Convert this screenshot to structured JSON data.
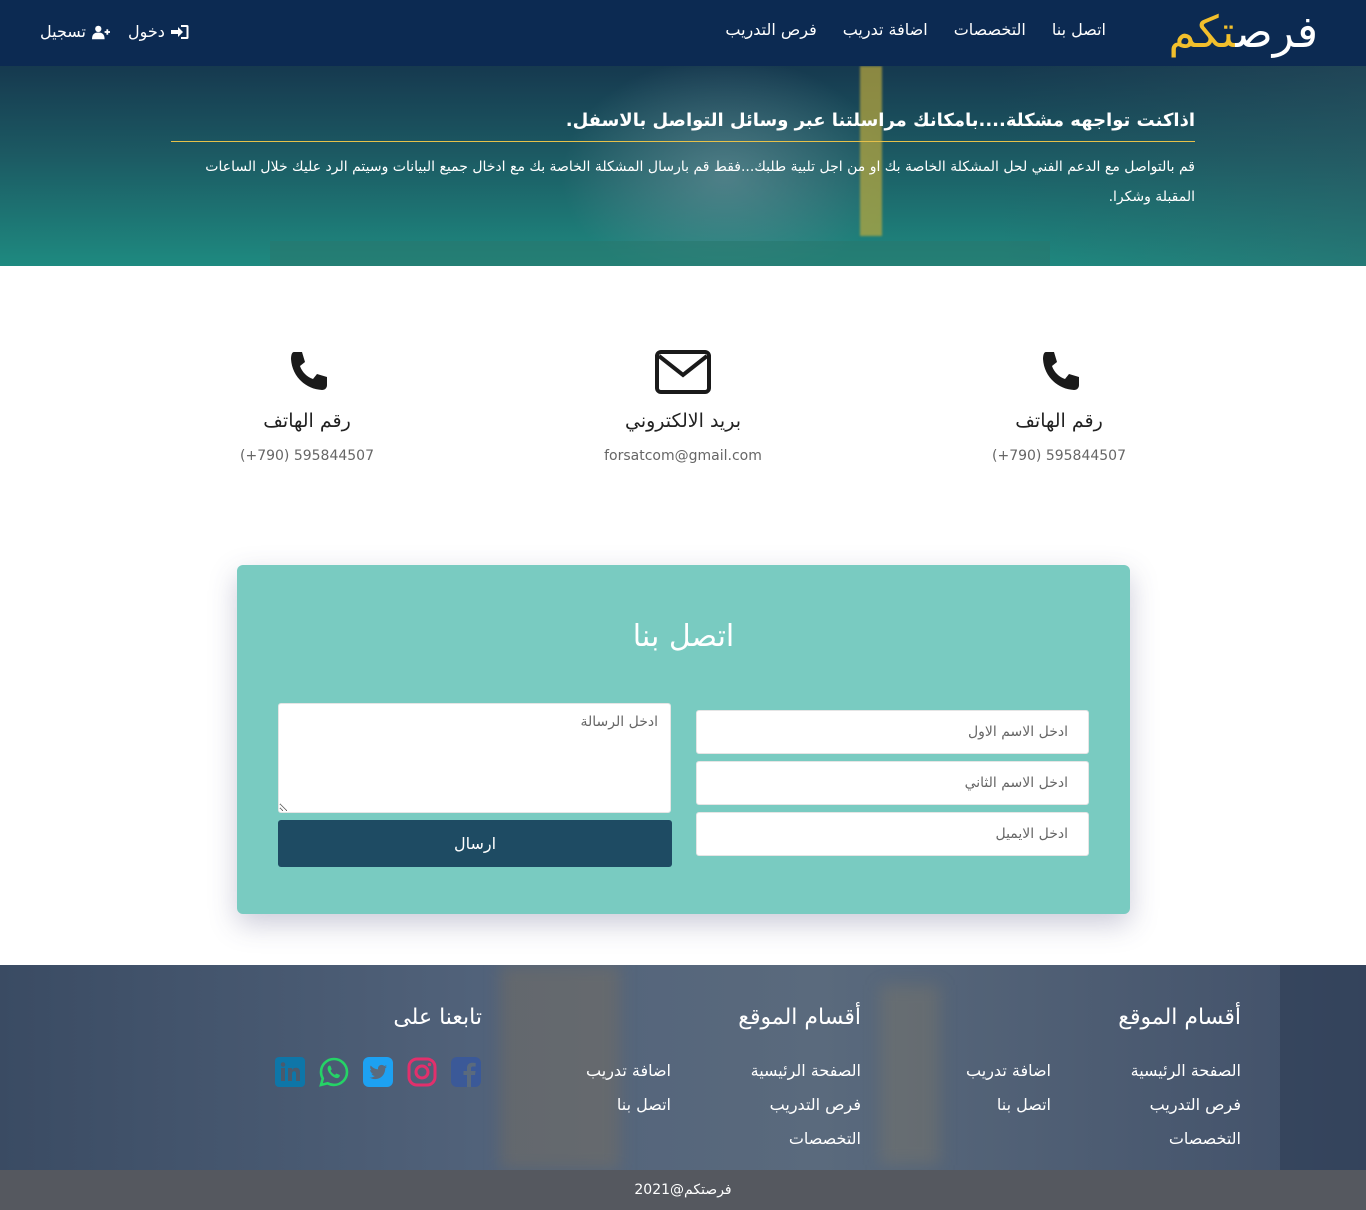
{
  "nav": {
    "logo_part1": "فرص",
    "logo_part2": "تكم",
    "links": [
      "فرص التدريب",
      "اضافة تدريب",
      "التخصصات",
      "اتصل بنا"
    ],
    "login": "دخول",
    "register": "تسجيل"
  },
  "hero": {
    "title": "اذاكنت تواجهه مشكلة....بامكانك مراسلتنا عبر وسائل التواصل بالاسفل.",
    "text": "قم بالتواصل مع الدعم الفني لحل المشكلة الخاصة بك او من اجل تلبية طلبك...فقط قم بارسال المشكلة الخاصة بك مع ادخال جميع البيانات وسيتم الرد عليك خلال الساعات المقبلة وشكرا."
  },
  "contact_info": [
    {
      "icon": "phone-icon",
      "title": "رقم الهاتف",
      "value": "(+790) 595844507"
    },
    {
      "icon": "envelope-icon",
      "title": "بريد الالكتروني",
      "value": "forsatcom@gmail.com"
    },
    {
      "icon": "phone-icon",
      "title": "رقم الهاتف",
      "value": "(+790) 595844507"
    }
  ],
  "form": {
    "title": "اتصل بنا",
    "first_name_placeholder": "ادخل الاسم الاول",
    "last_name_placeholder": "ادخل الاسم الثاني",
    "email_placeholder": "ادخل الايميل",
    "message_placeholder": "ادخل الرسالة",
    "send_label": "ارسال"
  },
  "footer": {
    "col1": {
      "title": "أقسام الموقع",
      "left": [
        "اضافة تدريب",
        "اتصل بنا"
      ],
      "right": [
        "الصفحة الرئيسية",
        "فرص التدريب",
        "التخصصات"
      ]
    },
    "col2": {
      "title": "أقسام الموقع",
      "left": [
        "اضافة تدريب",
        "اتصل بنا"
      ],
      "right": [
        "الصفحة الرئيسية",
        "فرص التدريب",
        "التخصصات"
      ]
    },
    "follow_title": "تابعنا على",
    "social": [
      {
        "icon": "facebook-icon",
        "color": "#3b5998"
      },
      {
        "icon": "instagram-icon",
        "color": "#e1306c"
      },
      {
        "icon": "twitter-icon",
        "color": "#1da1f2"
      },
      {
        "icon": "whatsapp-icon",
        "color": "#25d366"
      },
      {
        "icon": "linkedin-icon",
        "color": "#0e76a8"
      }
    ],
    "copyright": "فرصتكم@2021"
  },
  "colors": {
    "navbar": "#0c2a52",
    "logo_accent": "#f2bf2c",
    "card": "#79cbc1",
    "button": "#1e4b63"
  }
}
